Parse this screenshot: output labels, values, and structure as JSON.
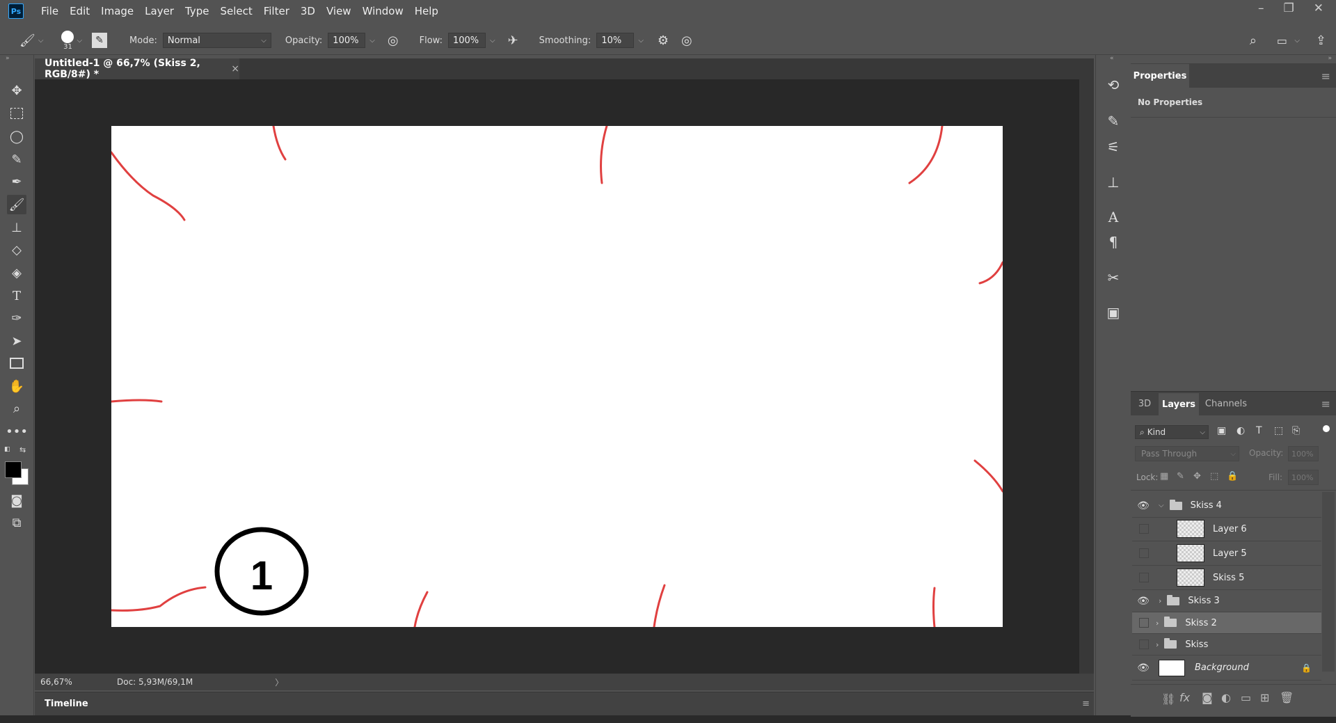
{
  "app": {
    "logo": "Ps"
  },
  "menu": [
    "File",
    "Edit",
    "Image",
    "Layer",
    "Type",
    "Select",
    "Filter",
    "3D",
    "View",
    "Window",
    "Help"
  ],
  "window_controls": {
    "minimize": "–",
    "restore": "❐",
    "close": "✕"
  },
  "options": {
    "brush_size": "31",
    "mode_label": "Mode:",
    "mode_value": "Normal",
    "opacity_label": "Opacity:",
    "opacity_value": "100%",
    "flow_label": "Flow:",
    "flow_value": "100%",
    "smoothing_label": "Smoothing:",
    "smoothing_value": "10%"
  },
  "document": {
    "tab_title": "Untitled-1 @ 66,7% (Skiss 2, RGB/8#) *",
    "tab_close": "×",
    "zoom": "66,67%",
    "doc_info": "Doc: 5,93M/69,1M",
    "status_arrow": "〉",
    "canvas_number": "1"
  },
  "timeline": {
    "label": "Timeline"
  },
  "properties": {
    "tab": "Properties",
    "empty_text": "No Properties"
  },
  "layers_panel": {
    "tabs": [
      "3D",
      "Layers",
      "Channels"
    ],
    "active_tab": "Layers",
    "filter_kind": "Kind",
    "blend_mode": "Pass Through",
    "opacity_label": "Opacity:",
    "opacity_value": "100%",
    "lock_label": "Lock:",
    "fill_label": "Fill:",
    "fill_value": "100%",
    "layers": [
      {
        "name": "Skiss 4",
        "type": "group",
        "expanded": true,
        "visible": true,
        "indent": 0
      },
      {
        "name": "Layer 6",
        "type": "layer",
        "visible": false,
        "indent": 1
      },
      {
        "name": "Layer 5",
        "type": "layer",
        "visible": false,
        "indent": 1
      },
      {
        "name": "Skiss 5",
        "type": "layer",
        "visible": false,
        "indent": 1
      },
      {
        "name": "Skiss 3",
        "type": "group",
        "expanded": false,
        "visible": true,
        "indent": 0
      },
      {
        "name": "Skiss 2",
        "type": "group",
        "expanded": false,
        "visible": false,
        "indent": 0,
        "selected": true
      },
      {
        "name": "Skiss",
        "type": "group",
        "expanded": false,
        "visible": false,
        "indent": 0
      },
      {
        "name": "Background",
        "type": "background",
        "visible": true,
        "locked": true,
        "indent": 0
      }
    ]
  },
  "colors": {
    "foreground": "#000000",
    "background": "#ffffff",
    "stroke_red": "#e04040"
  }
}
